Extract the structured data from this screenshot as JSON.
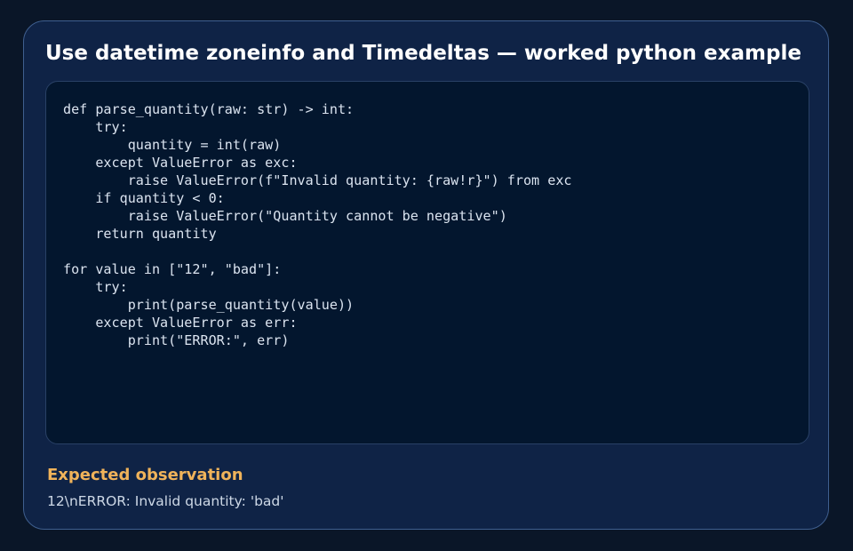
{
  "card": {
    "title": "Use datetime zoneinfo and Timedeltas — worked python example",
    "code": "def parse_quantity(raw: str) -> int:\n    try:\n        quantity = int(raw)\n    except ValueError as exc:\n        raise ValueError(f\"Invalid quantity: {raw!r}\") from exc\n    if quantity < 0:\n        raise ValueError(\"Quantity cannot be negative\")\n    return quantity\n\nfor value in [\"12\", \"bad\"]:\n    try:\n        print(parse_quantity(value))\n    except ValueError as err:\n        print(\"ERROR:\", err)",
    "observation": {
      "heading": "Expected observation",
      "text": "12\\nERROR: Invalid quantity: 'bad'"
    }
  },
  "colors": {
    "page_background": "#0a1628",
    "card_background": "#0f2346",
    "card_border": "#3f5f8f",
    "code_background": "#03162e",
    "code_text": "#dbe4f0",
    "title_text": "#ffffff",
    "observation_heading": "#f0b35a",
    "observation_text": "#cdd8e6"
  }
}
